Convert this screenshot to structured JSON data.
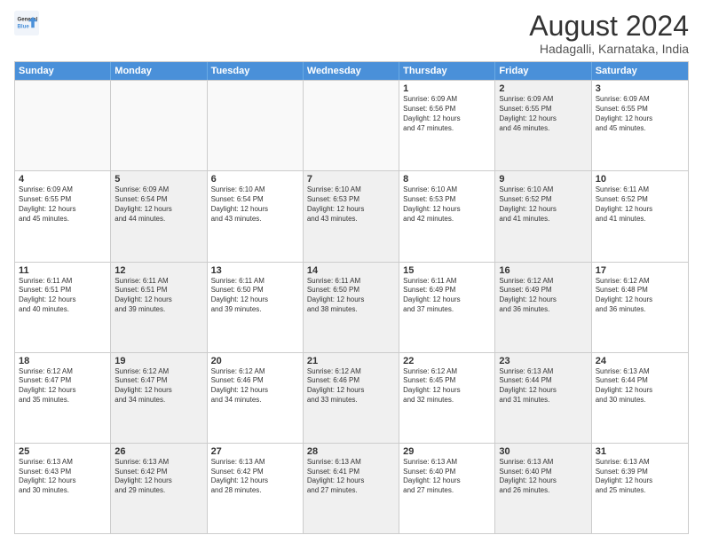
{
  "logo": {
    "line1": "General",
    "line2": "Blue"
  },
  "title": "August 2024",
  "subtitle": "Hadagalli, Karnataka, India",
  "header_days": [
    "Sunday",
    "Monday",
    "Tuesday",
    "Wednesday",
    "Thursday",
    "Friday",
    "Saturday"
  ],
  "rows": [
    [
      {
        "day": "",
        "text": "",
        "empty": true
      },
      {
        "day": "",
        "text": "",
        "empty": true
      },
      {
        "day": "",
        "text": "",
        "empty": true
      },
      {
        "day": "",
        "text": "",
        "empty": true
      },
      {
        "day": "1",
        "text": "Sunrise: 6:09 AM\nSunset: 6:56 PM\nDaylight: 12 hours\nand 47 minutes."
      },
      {
        "day": "2",
        "text": "Sunrise: 6:09 AM\nSunset: 6:55 PM\nDaylight: 12 hours\nand 46 minutes.",
        "shaded": true
      },
      {
        "day": "3",
        "text": "Sunrise: 6:09 AM\nSunset: 6:55 PM\nDaylight: 12 hours\nand 45 minutes."
      }
    ],
    [
      {
        "day": "4",
        "text": "Sunrise: 6:09 AM\nSunset: 6:55 PM\nDaylight: 12 hours\nand 45 minutes."
      },
      {
        "day": "5",
        "text": "Sunrise: 6:09 AM\nSunset: 6:54 PM\nDaylight: 12 hours\nand 44 minutes.",
        "shaded": true
      },
      {
        "day": "6",
        "text": "Sunrise: 6:10 AM\nSunset: 6:54 PM\nDaylight: 12 hours\nand 43 minutes."
      },
      {
        "day": "7",
        "text": "Sunrise: 6:10 AM\nSunset: 6:53 PM\nDaylight: 12 hours\nand 43 minutes.",
        "shaded": true
      },
      {
        "day": "8",
        "text": "Sunrise: 6:10 AM\nSunset: 6:53 PM\nDaylight: 12 hours\nand 42 minutes."
      },
      {
        "day": "9",
        "text": "Sunrise: 6:10 AM\nSunset: 6:52 PM\nDaylight: 12 hours\nand 41 minutes.",
        "shaded": true
      },
      {
        "day": "10",
        "text": "Sunrise: 6:11 AM\nSunset: 6:52 PM\nDaylight: 12 hours\nand 41 minutes."
      }
    ],
    [
      {
        "day": "11",
        "text": "Sunrise: 6:11 AM\nSunset: 6:51 PM\nDaylight: 12 hours\nand 40 minutes."
      },
      {
        "day": "12",
        "text": "Sunrise: 6:11 AM\nSunset: 6:51 PM\nDaylight: 12 hours\nand 39 minutes.",
        "shaded": true
      },
      {
        "day": "13",
        "text": "Sunrise: 6:11 AM\nSunset: 6:50 PM\nDaylight: 12 hours\nand 39 minutes."
      },
      {
        "day": "14",
        "text": "Sunrise: 6:11 AM\nSunset: 6:50 PM\nDaylight: 12 hours\nand 38 minutes.",
        "shaded": true
      },
      {
        "day": "15",
        "text": "Sunrise: 6:11 AM\nSunset: 6:49 PM\nDaylight: 12 hours\nand 37 minutes."
      },
      {
        "day": "16",
        "text": "Sunrise: 6:12 AM\nSunset: 6:49 PM\nDaylight: 12 hours\nand 36 minutes.",
        "shaded": true
      },
      {
        "day": "17",
        "text": "Sunrise: 6:12 AM\nSunset: 6:48 PM\nDaylight: 12 hours\nand 36 minutes."
      }
    ],
    [
      {
        "day": "18",
        "text": "Sunrise: 6:12 AM\nSunset: 6:47 PM\nDaylight: 12 hours\nand 35 minutes."
      },
      {
        "day": "19",
        "text": "Sunrise: 6:12 AM\nSunset: 6:47 PM\nDaylight: 12 hours\nand 34 minutes.",
        "shaded": true
      },
      {
        "day": "20",
        "text": "Sunrise: 6:12 AM\nSunset: 6:46 PM\nDaylight: 12 hours\nand 34 minutes."
      },
      {
        "day": "21",
        "text": "Sunrise: 6:12 AM\nSunset: 6:46 PM\nDaylight: 12 hours\nand 33 minutes.",
        "shaded": true
      },
      {
        "day": "22",
        "text": "Sunrise: 6:12 AM\nSunset: 6:45 PM\nDaylight: 12 hours\nand 32 minutes."
      },
      {
        "day": "23",
        "text": "Sunrise: 6:13 AM\nSunset: 6:44 PM\nDaylight: 12 hours\nand 31 minutes.",
        "shaded": true
      },
      {
        "day": "24",
        "text": "Sunrise: 6:13 AM\nSunset: 6:44 PM\nDaylight: 12 hours\nand 30 minutes."
      }
    ],
    [
      {
        "day": "25",
        "text": "Sunrise: 6:13 AM\nSunset: 6:43 PM\nDaylight: 12 hours\nand 30 minutes."
      },
      {
        "day": "26",
        "text": "Sunrise: 6:13 AM\nSunset: 6:42 PM\nDaylight: 12 hours\nand 29 minutes.",
        "shaded": true
      },
      {
        "day": "27",
        "text": "Sunrise: 6:13 AM\nSunset: 6:42 PM\nDaylight: 12 hours\nand 28 minutes."
      },
      {
        "day": "28",
        "text": "Sunrise: 6:13 AM\nSunset: 6:41 PM\nDaylight: 12 hours\nand 27 minutes.",
        "shaded": true
      },
      {
        "day": "29",
        "text": "Sunrise: 6:13 AM\nSunset: 6:40 PM\nDaylight: 12 hours\nand 27 minutes."
      },
      {
        "day": "30",
        "text": "Sunrise: 6:13 AM\nSunset: 6:40 PM\nDaylight: 12 hours\nand 26 minutes.",
        "shaded": true
      },
      {
        "day": "31",
        "text": "Sunrise: 6:13 AM\nSunset: 6:39 PM\nDaylight: 12 hours\nand 25 minutes."
      }
    ]
  ]
}
